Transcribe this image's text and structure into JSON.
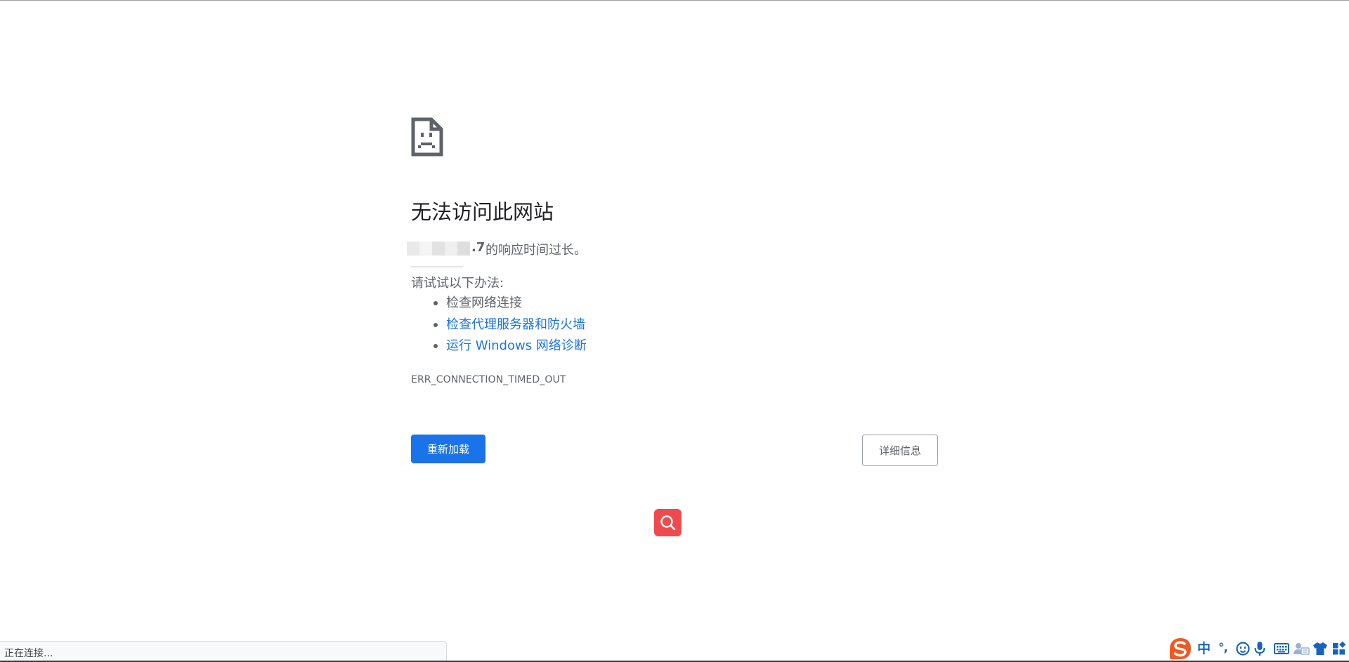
{
  "error_page": {
    "heading": "无法访问此网站",
    "host_suffix": ".7",
    "summary_text": "的响应时间过长。",
    "suggestions_heading": "请试试以下办法:",
    "suggestions": [
      {
        "label": "检查网络连接",
        "link": false
      },
      {
        "label": "检查代理服务器和防火墙",
        "link": true
      },
      {
        "label": "运行 Windows 网络诊断",
        "link": true
      }
    ],
    "error_code": "ERR_CONNECTION_TIMED_OUT",
    "reload_label": "重新加载",
    "details_label": "详细信息"
  },
  "status_bar": {
    "text": "正在连接..."
  },
  "ime_toolbar": {
    "language_label": "中",
    "punctuation_label": "°,"
  },
  "colors": {
    "primary_blue": "#1a73e8",
    "text_gray": "#5f6368",
    "heading_dark": "#202124",
    "search_button_red": "#ef4b4f",
    "ime_blue": "#1565c0",
    "ime_logo_orange": "#ef5a24"
  },
  "icons": {
    "page_icon": "sad-file-icon",
    "floating_button_icon": "magnifier-icon",
    "ime_icons": [
      "sogou-logo-icon",
      "emoji-face-icon",
      "microphone-icon",
      "keyboard-icon",
      "user-card-icon",
      "skin-shirt-icon",
      "toolbox-grid-icon"
    ]
  }
}
